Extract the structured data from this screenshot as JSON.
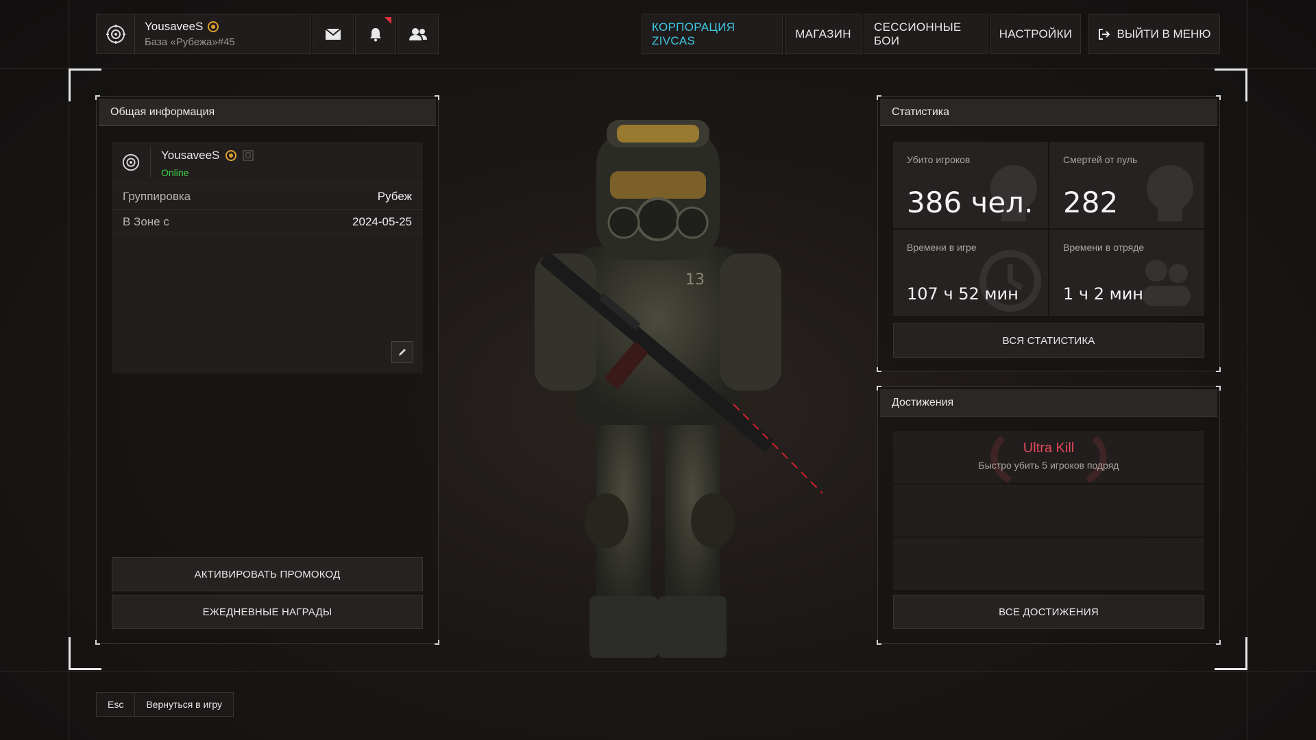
{
  "header": {
    "player_name": "YousaveeS",
    "base_label": "База «Рубежа»#45",
    "mail_icon": "envelope-icon",
    "notifications_icon": "bell-icon",
    "friends_icon": "users-icon"
  },
  "nav": {
    "items": [
      {
        "label": "КОРПОРАЦИЯ ZIVCAS",
        "active": true
      },
      {
        "label": "МАГАЗИН",
        "active": false
      },
      {
        "label": "СЕССИОННЫЕ БОИ",
        "active": false
      },
      {
        "label": "НАСТРОЙКИ",
        "active": false
      }
    ],
    "exit_label": "ВЫЙТИ В МЕНЮ"
  },
  "general": {
    "title": "Общая информация",
    "player_name": "YousaveeS",
    "status": "Online",
    "rows": [
      {
        "key": "Группировка",
        "value": "Рубеж"
      },
      {
        "key": "В Зоне с",
        "value": "2024-05-25"
      }
    ],
    "promo_button": "АКТИВИРОВАТЬ ПРОМОКОД",
    "daily_button": "ЕЖЕДНЕВНЫЕ НАГРАДЫ"
  },
  "stats": {
    "title": "Статистика",
    "cells": [
      {
        "label": "Убито игроков",
        "value": "386 чел."
      },
      {
        "label": "Смертей от пуль",
        "value": "282"
      },
      {
        "label": "Времени в игре",
        "value": "107 ч 52 мин"
      },
      {
        "label": "Времени в отряде",
        "value": "1 ч 2 мин"
      }
    ],
    "all_button": "ВСЯ СТАТИСТИКА"
  },
  "achievements": {
    "title": "Достижения",
    "items": [
      {
        "name": "Ultra Kill",
        "description": "Быстро убить 5 игроков подряд"
      }
    ],
    "all_button": "ВСЕ ДОСТИЖЕНИЯ"
  },
  "footer": {
    "key": "Esc",
    "label": "Вернуться в игру"
  },
  "colors": {
    "accent": "#3ec8e6",
    "online": "#3fcf4a",
    "achievement": "#e04a5a"
  }
}
